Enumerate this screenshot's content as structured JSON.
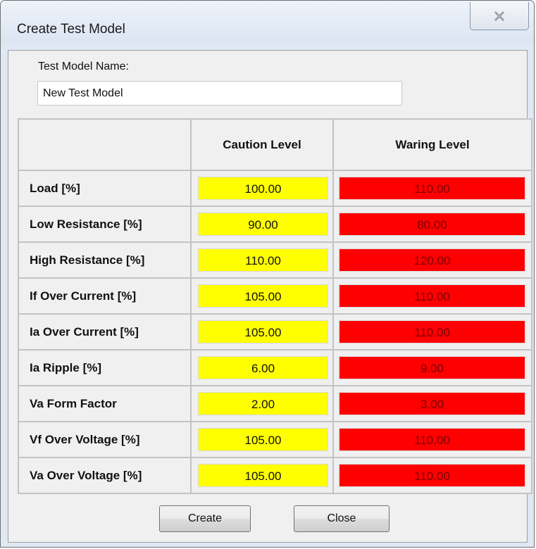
{
  "window": {
    "title": "Create Test Model",
    "close_icon": "close-icon"
  },
  "name_field": {
    "label": "Test Model Name:",
    "value": "New Test Model"
  },
  "table": {
    "headers": [
      "",
      "Caution Level",
      "Waring Level"
    ],
    "caution_color": "#ffff00",
    "warning_color": "#ff0000",
    "rows": [
      {
        "label": "Load [%]",
        "caution": "100.00",
        "warning": "110.00"
      },
      {
        "label": "Low Resistance [%]",
        "caution": "90.00",
        "warning": "80.00"
      },
      {
        "label": "High Resistance [%]",
        "caution": "110.00",
        "warning": "120.00"
      },
      {
        "label": "If Over Current [%]",
        "caution": "105.00",
        "warning": "110.00"
      },
      {
        "label": "Ia Over Current [%]",
        "caution": "105.00",
        "warning": "110.00"
      },
      {
        "label": "Ia Ripple [%]",
        "caution": "6.00",
        "warning": "9.00"
      },
      {
        "label": "Va Form Factor",
        "caution": "2.00",
        "warning": "3.00"
      },
      {
        "label": "Vf Over Voltage [%]",
        "caution": "105.00",
        "warning": "110.00"
      },
      {
        "label": "Va Over Voltage [%]",
        "caution": "105.00",
        "warning": "110.00"
      }
    ]
  },
  "buttons": {
    "create_label": "Create",
    "close_label": "Close"
  }
}
